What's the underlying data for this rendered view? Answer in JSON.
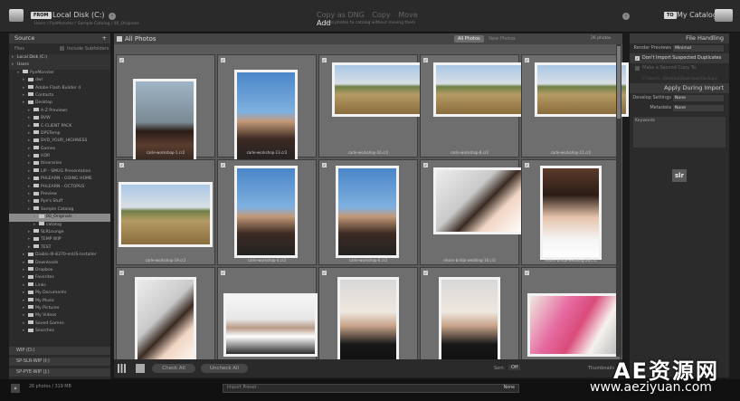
{
  "top": {
    "from_tag": "FROM",
    "from_location": "Local Disk (C:)",
    "from_path": "Users / PyeMonster / Sample Catalog / 00_Originals",
    "modes": [
      "Copy as DNG",
      "Copy",
      "Move",
      "Add"
    ],
    "active_mode": "Add",
    "mode_description": "Add photos to catalog without moving them",
    "to_tag": "TO",
    "to_location": "My Catalog"
  },
  "source": {
    "header": "Source",
    "files_label": "Files",
    "include_subfolders": "Include Subfolders",
    "tree": [
      {
        "label": "Local Disk (C:)",
        "level": 0,
        "type": "section"
      },
      {
        "label": "Users",
        "level": 0,
        "type": "section"
      },
      {
        "label": "PyeMonster",
        "level": 1,
        "type": "folder"
      },
      {
        "label": "dwl",
        "level": 2,
        "type": "folder"
      },
      {
        "label": "Adobe Flash Builder 4",
        "level": 2,
        "type": "folder"
      },
      {
        "label": "Contacts",
        "level": 2,
        "type": "folder"
      },
      {
        "label": "Desktop",
        "level": 2,
        "type": "folder"
      },
      {
        "label": "A-Z Previews",
        "level": 3,
        "type": "folder"
      },
      {
        "label": "BVW",
        "level": 3,
        "type": "folder"
      },
      {
        "label": "C-CLIENT PACK",
        "level": 3,
        "type": "folder"
      },
      {
        "label": "DPSTemp",
        "level": 3,
        "type": "folder"
      },
      {
        "label": "DVD_YOUR_HIGHNESS",
        "level": 3,
        "type": "folder"
      },
      {
        "label": "Games",
        "level": 3,
        "type": "folder"
      },
      {
        "label": "HDR",
        "level": 3,
        "type": "folder"
      },
      {
        "label": "Itineraries",
        "level": 3,
        "type": "folder"
      },
      {
        "label": "LIP - SMUG Presentation",
        "level": 3,
        "type": "folder"
      },
      {
        "label": "PHLEARN - GOING HOME",
        "level": 3,
        "type": "folder"
      },
      {
        "label": "PHLEARN - OCTOPUS",
        "level": 3,
        "type": "folder"
      },
      {
        "label": "Preview",
        "level": 3,
        "type": "folder"
      },
      {
        "label": "Pye's Stuff",
        "level": 3,
        "type": "folder"
      },
      {
        "label": "Sample Catalog",
        "level": 3,
        "type": "folder"
      },
      {
        "label": "00_Originals",
        "level": 4,
        "type": "selected"
      },
      {
        "label": "catalog",
        "level": 4,
        "type": "folder"
      },
      {
        "label": "SLRLounge",
        "level": 3,
        "type": "folder"
      },
      {
        "label": "TEMP WIP",
        "level": 3,
        "type": "folder"
      },
      {
        "label": "TEST",
        "level": 3,
        "type": "folder"
      },
      {
        "label": "Diablo-III-8370-enUS-Installer",
        "level": 2,
        "type": "folder"
      },
      {
        "label": "Downloads",
        "level": 2,
        "type": "folder"
      },
      {
        "label": "Dropbox",
        "level": 2,
        "type": "folder"
      },
      {
        "label": "Favorites",
        "level": 2,
        "type": "folder"
      },
      {
        "label": "Links",
        "level": 2,
        "type": "folder"
      },
      {
        "label": "My Documents",
        "level": 2,
        "type": "folder"
      },
      {
        "label": "My Music",
        "level": 2,
        "type": "folder"
      },
      {
        "label": "My Pictures",
        "level": 2,
        "type": "folder"
      },
      {
        "label": "My Videos",
        "level": 2,
        "type": "folder"
      },
      {
        "label": "Saved Games",
        "level": 2,
        "type": "folder"
      },
      {
        "label": "Searches",
        "level": 2,
        "type": "folder"
      }
    ],
    "bottom_volumes": [
      "WIP (D:)",
      "SP-SLR-WIP (I:)",
      "SP-PYE-WIP (J:)"
    ]
  },
  "grid": {
    "title": "All Photos",
    "tabs": [
      "All Photos",
      "New Photos"
    ],
    "count": "26 photos",
    "photos": [
      {
        "file": "carle-workshop-1.cr2",
        "scene": "portrait-dark"
      },
      {
        "file": "carle-workshop-13.cr2",
        "scene": "portrait-sky"
      },
      {
        "file": "carle-workshop-16.cr2",
        "scene": "field"
      },
      {
        "file": "carle-workshop-8.cr2",
        "scene": "field"
      },
      {
        "file": "carle-workshop-11.cr2",
        "scene": "field"
      },
      {
        "file": "carle-workshop-19.cr2",
        "scene": "field"
      },
      {
        "file": "carle-workshop-4.cr2",
        "scene": "portrait-sky"
      },
      {
        "file": "carle-workshop-6.cr2",
        "scene": "portrait-sky"
      },
      {
        "file": "ehsen-bridal-wedding-16.cr2",
        "scene": "bride"
      },
      {
        "file": "ehsen-bridal-wedding-28.cr2",
        "scene": "bride-dark"
      },
      {
        "file": "",
        "scene": "bride"
      },
      {
        "file": "",
        "scene": "groom-white"
      },
      {
        "file": "",
        "scene": "groom-dark"
      },
      {
        "file": "",
        "scene": "groom-dark"
      },
      {
        "file": "",
        "scene": "colorful"
      }
    ]
  },
  "toolbar": {
    "check_all": "Check All",
    "uncheck_all": "Uncheck All",
    "sort_label": "Sort:",
    "sort_value": "Off",
    "thumbnails_label": "Thumbnails"
  },
  "right_panel": {
    "file_handling": "File Handling",
    "render_previews_label": "Render Previews",
    "render_previews_value": "Minimal",
    "dont_import_duplicates": "Don't Import Suspected Duplicates",
    "make_second_copy": "Make a Second Copy To:",
    "second_copy_path": "C:\\Users\\...\\Desktop\\Download Backups",
    "apply_during_import": "Apply During Import",
    "develop_settings_label": "Develop Settings",
    "develop_settings_value": "None",
    "metadata_label": "Metadata",
    "metadata_value": "None",
    "keywords_label": "Keywords",
    "logo": "slr"
  },
  "bottom": {
    "photo_count": "26 photos / 319 MB",
    "import_preset_label": "Import Preset :",
    "import_preset_value": "None"
  },
  "watermark": {
    "title": "AE资源网",
    "url": "www.aeziyuan.com"
  }
}
